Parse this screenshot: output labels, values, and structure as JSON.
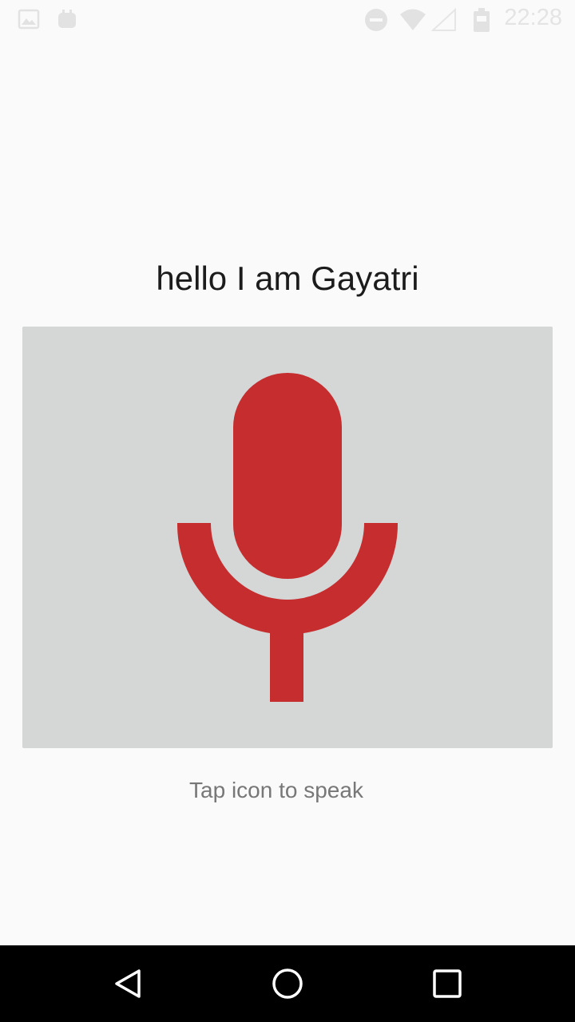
{
  "status_bar": {
    "time": "22:28",
    "icons": [
      "image-icon",
      "android-icon",
      "do-not-disturb-icon",
      "wifi-icon",
      "signal-icon",
      "battery-icon"
    ]
  },
  "main": {
    "heading": "hello I am Gayatri",
    "mic_icon": "microphone-icon",
    "hint": "Tap icon to speak"
  },
  "colors": {
    "mic_red": "#c62d2f",
    "panel_gray": "#d5d6d6",
    "background": "#fafafa"
  },
  "nav_bar": {
    "buttons": [
      "back-icon",
      "home-icon",
      "recents-icon"
    ]
  }
}
